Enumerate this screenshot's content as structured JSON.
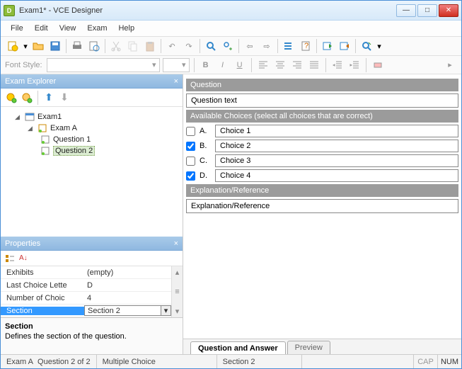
{
  "title": "Exam1* - VCE Designer",
  "menu": {
    "file": "File",
    "edit": "Edit",
    "view": "View",
    "exam": "Exam",
    "help": "Help"
  },
  "fontbar": {
    "label": "Font Style:",
    "bold": "B",
    "italic": "I",
    "underline": "U"
  },
  "explorer": {
    "title": "Exam Explorer",
    "root": "Exam1",
    "section": "Exam A",
    "q1": "Question 1",
    "q2": "Question 2"
  },
  "properties": {
    "title": "Properties",
    "rows": {
      "exhibits": {
        "name": "Exhibits",
        "value": "(empty)"
      },
      "lastChoice": {
        "name": "Last Choice Lette",
        "value": "D"
      },
      "numChoices": {
        "name": "Number of Choic",
        "value": "4"
      },
      "section": {
        "name": "Section",
        "value": "Section 2"
      }
    },
    "desc": {
      "title": "Section",
      "text": "Defines the section of the question."
    }
  },
  "question": {
    "hdrQuestion": "Question",
    "questionText": "Question text",
    "hdrChoices": "Available Choices (select all choices that are correct)",
    "choices": {
      "a": {
        "label": "A.",
        "value": "Choice 1"
      },
      "b": {
        "label": "B.",
        "value": "Choice 2"
      },
      "c": {
        "label": "C.",
        "value": "Choice 3"
      },
      "d": {
        "label": "D.",
        "value": "Choice 4"
      }
    },
    "hdrExplanation": "Explanation/Reference",
    "explanationText": "Explanation/Reference"
  },
  "tabs": {
    "qa": "Question and Answer",
    "preview": "Preview"
  },
  "status": {
    "section": "Exam A",
    "pos": "Question 2 of 2",
    "type": "Multiple Choice",
    "sec2": "Section 2",
    "cap": "CAP",
    "num": "NUM"
  }
}
